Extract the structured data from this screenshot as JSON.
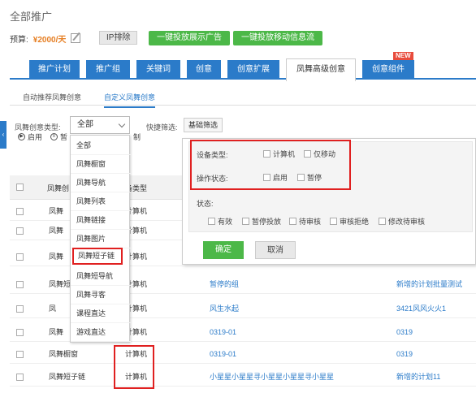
{
  "header": {
    "title": "全部推广",
    "budget_label": "预算:",
    "budget_value": "¥2000/天",
    "ip_exclude": "IP排除",
    "btn_display_ads": "一键投放展示广告",
    "btn_mobile_ads": "一键投放移动信息流"
  },
  "tabs": [
    {
      "label": "推广计划"
    },
    {
      "label": "推广组"
    },
    {
      "label": "关键词"
    },
    {
      "label": "创意"
    },
    {
      "label": "创意扩展"
    },
    {
      "label": "凤舞高级创意"
    },
    {
      "label": "创意组件"
    }
  ],
  "new_badge": "NEW",
  "subtabs": [
    {
      "label": "自动推荐凤舞创意"
    },
    {
      "label": "自定义凤舞创意"
    }
  ],
  "filters": {
    "type_label": "凤舞创意类型:",
    "type_selected": "全部",
    "quick_label": "快捷筛选:",
    "quick_button": "基础筛选"
  },
  "toolbar": {
    "enable": "启用",
    "pause": "暂",
    "copy_suffix": "制"
  },
  "dropdown_options": [
    "全部",
    "凤舞橱窗",
    "凤舞导航",
    "凤舞列表",
    "凤舞链接",
    "凤舞图片",
    "凤舞短子链",
    "凤舞短导航",
    "凤舞寻客",
    "课程直达",
    "游戏直达"
  ],
  "panel": {
    "device_label": "设备类型:",
    "device_pc": "计算机",
    "device_mobile": "仅移动",
    "op_label": "操作状态:",
    "op_enable": "启用",
    "op_pause": "暂停",
    "status_label": "状态:",
    "status_options": [
      "有效",
      "暂停投放",
      "待审核",
      "审核拒绝",
      "修改待审核"
    ],
    "confirm": "确定",
    "cancel": "取消"
  },
  "table": {
    "headers": [
      "凤舞创",
      "备类型"
    ],
    "rows": [
      {
        "name": "凤舞",
        "device": "计算机",
        "group": "",
        "plan": ""
      },
      {
        "name": "凤舞",
        "device": "计算机",
        "group": "",
        "plan": ""
      },
      {
        "name": "凤舞",
        "device": "计算机",
        "group": "",
        "plan": ""
      },
      {
        "name": "凤舞短",
        "device": "计算机",
        "group": "暂停的组",
        "plan": "新增的计划批量测试"
      },
      {
        "name": "凤",
        "device": "计算机",
        "group": "风生水起",
        "plan": "3421风风火火1"
      },
      {
        "name": "凤舞",
        "device": "计算机",
        "group": "0319-01",
        "plan": "0319"
      },
      {
        "name": "凤舞橱窗",
        "device": "计算机",
        "group": "0319-01",
        "plan": "0319"
      },
      {
        "name": "凤舞短子链",
        "device": "计算机",
        "group": "小星星小星星寻小星星小星星寻小星星",
        "plan": "新增的计划11"
      }
    ]
  },
  "colors": {
    "tab_blue": "#2b7bc9",
    "green": "#4cb848",
    "highlight_red": "#e02020",
    "budget_orange": "#e67e22"
  }
}
